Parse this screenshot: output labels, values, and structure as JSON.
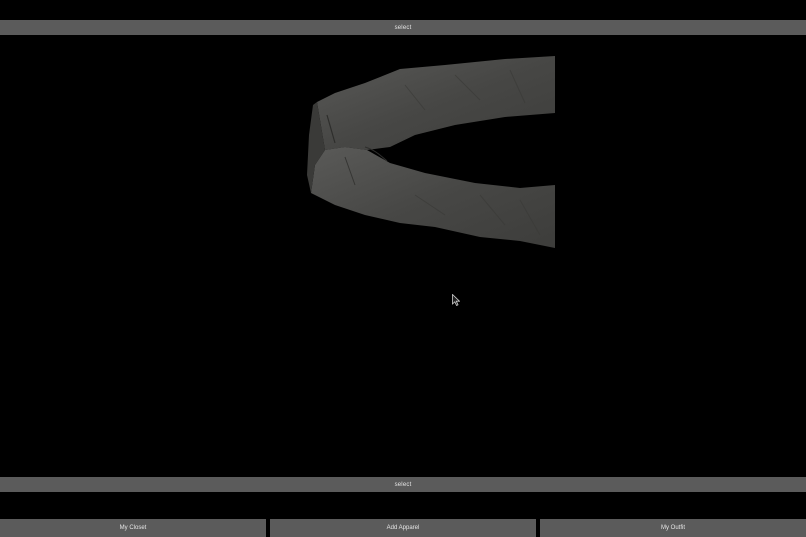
{
  "top_bar": {
    "label": "select"
  },
  "bottom_bar": {
    "label": "select"
  },
  "nav": {
    "items": [
      {
        "label": "My Closet"
      },
      {
        "label": "Add Apparel"
      },
      {
        "label": "My Outfit"
      }
    ]
  },
  "colors": {
    "background": "#000000",
    "button": "#5b5b5b",
    "button_text": "#e6e6e6",
    "garment": "#4a4a48"
  },
  "icons": {
    "cursor": "mouse-pointer-icon"
  }
}
